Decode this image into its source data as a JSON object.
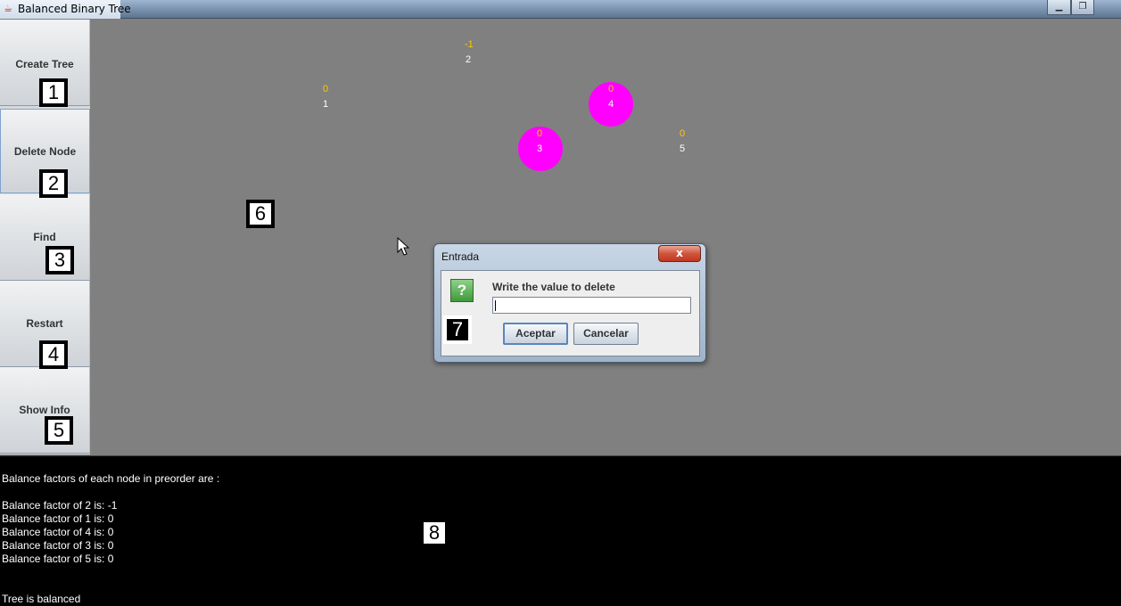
{
  "window": {
    "title": "Balanced Binary Tree",
    "icon": "java-cup-icon",
    "controls": {
      "minimize": "▁",
      "maximize": "❐"
    }
  },
  "sidebar": {
    "items": [
      {
        "label": "Create Tree",
        "tag": "1"
      },
      {
        "label": "Delete Node",
        "tag": "2"
      },
      {
        "label": "Find",
        "tag": "3"
      },
      {
        "label": "Restart",
        "tag": "4"
      },
      {
        "label": "Show Info",
        "tag": "5"
      }
    ]
  },
  "canvas": {
    "tag": "6",
    "nodes": [
      {
        "value": "2",
        "balance": "-1",
        "highlighted": false
      },
      {
        "value": "1",
        "balance": "0",
        "highlighted": false
      },
      {
        "value": "4",
        "balance": "0",
        "highlighted": true
      },
      {
        "value": "3",
        "balance": "0",
        "highlighted": true
      },
      {
        "value": "5",
        "balance": "0",
        "highlighted": false
      }
    ],
    "colors": {
      "balance": "#ffc800",
      "value": "#ffffff",
      "highlight": "#ff00ff",
      "background": "#808080"
    }
  },
  "dialog": {
    "title": "Entrada",
    "close_label": "x",
    "prompt": "Write the value to delete",
    "input_value": "",
    "ok_label": "Aceptar",
    "cancel_label": "Cancelar",
    "tag": "7",
    "icon": "question-icon",
    "icon_glyph": "?"
  },
  "console": {
    "tag": "8",
    "lines": [
      "Balance factors of each node in preorder are :",
      "",
      "Balance factor of 2 is: -1",
      "Balance factor of 1 is: 0",
      "Balance factor of 4 is: 0",
      "Balance factor of 3 is: 0",
      "Balance factor of 5 is: 0",
      "",
      "",
      "Tree is balanced"
    ]
  }
}
